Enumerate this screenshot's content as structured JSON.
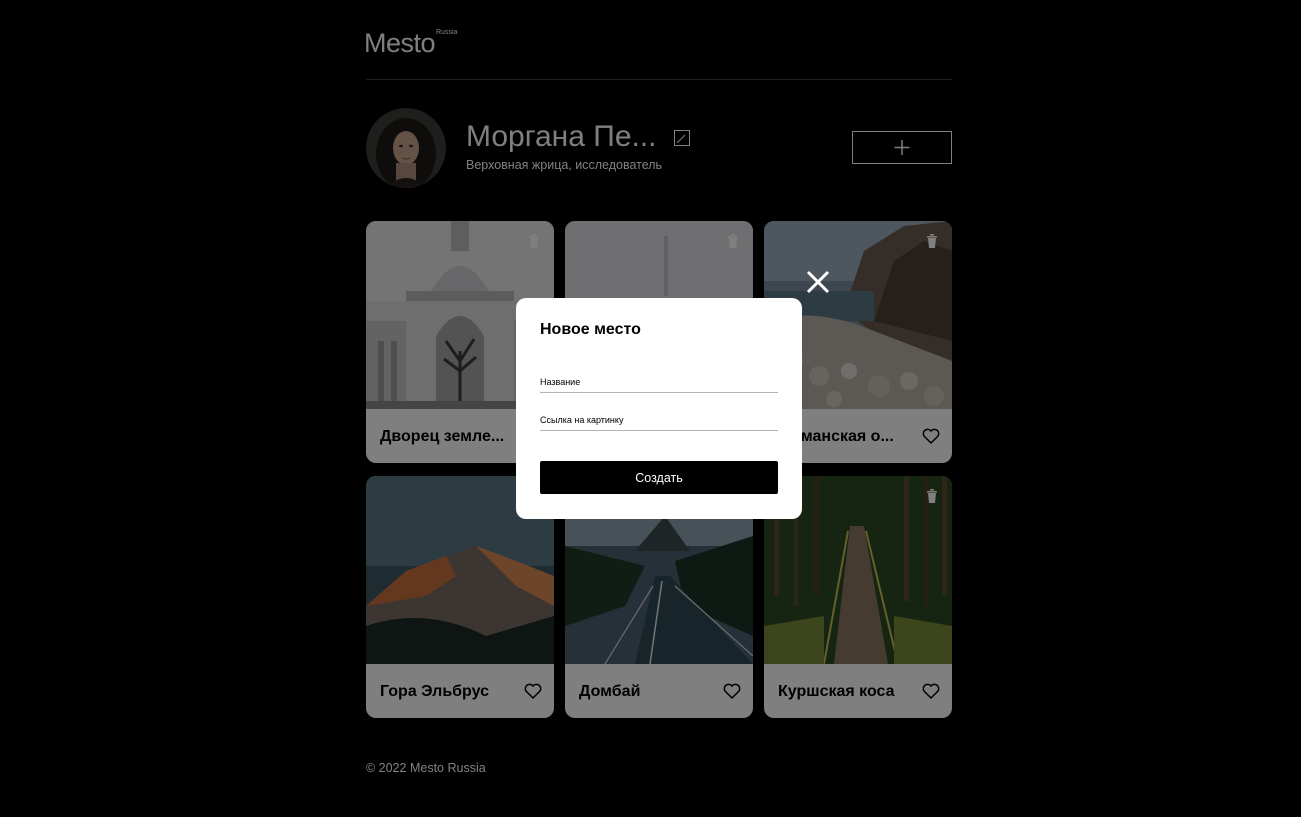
{
  "header": {
    "logo": "Mesto",
    "logo_sup": "Russia"
  },
  "profile": {
    "name": "Моргана Пе...",
    "about": "Верховная жрица, исследователь",
    "add_button_icon": "plus-icon",
    "edit_button_icon": "pencil-icon"
  },
  "cards": [
    {
      "title": "Дворец земле..."
    },
    {
      "title": ""
    },
    {
      "title": "...рманская о..."
    },
    {
      "title": "Гора Эльбрус"
    },
    {
      "title": "Домбай"
    },
    {
      "title": "Куршская коса"
    }
  ],
  "popup": {
    "title": "Новое место",
    "name_placeholder": "Название",
    "link_placeholder": "Ссылка на картинку",
    "submit_label": "Создать",
    "close_icon": "close-icon"
  },
  "footer": {
    "copyright": "© 2022 Mesto Russia"
  },
  "colors": {
    "background": "#000000",
    "overlay": "rgba(0,0,0,0.5)",
    "popup_bg": "#ffffff",
    "button_bg": "#000000"
  }
}
